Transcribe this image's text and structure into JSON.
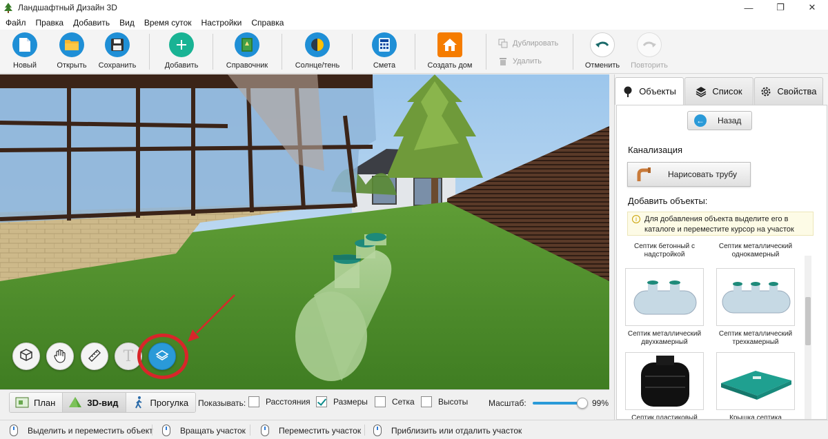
{
  "window": {
    "title": "Ландшафтный Дизайн 3D",
    "minimize": "—",
    "maximize": "❐",
    "close": "✕"
  },
  "menu": [
    "Файл",
    "Правка",
    "Добавить",
    "Вид",
    "Время суток",
    "Настройки",
    "Справка"
  ],
  "toolbar": {
    "new": "Новый",
    "open": "Открыть",
    "save": "Сохранить",
    "add": "Добавить",
    "reference": "Справочник",
    "sun_shadow": "Солнце/тень",
    "estimate": "Смета",
    "create_house": "Создать дом",
    "duplicate": "Дублировать",
    "delete": "Удалить",
    "undo": "Отменить",
    "redo": "Повторить"
  },
  "viewport_tools": {
    "text_tool": "T"
  },
  "modebar": {
    "plan": "План",
    "view3d": "3D-вид",
    "walk": "Прогулка",
    "show_label": "Показывать:",
    "distances": {
      "label": "Расстояния",
      "checked": false
    },
    "dimensions": {
      "label": "Размеры",
      "checked": true
    },
    "grid": {
      "label": "Сетка",
      "checked": false
    },
    "heights": {
      "label": "Высоты",
      "checked": false
    },
    "scale_label": "Масштаб:",
    "scale_value": "99%",
    "scale_fraction": 0.99
  },
  "status": {
    "select_move": "Выделить и переместить объект",
    "rotate": "Вращать участок",
    "move": "Переместить участок",
    "zoom": "Приблизить или отдалить участок"
  },
  "panel": {
    "tabs": [
      "Объекты",
      "Список",
      "Свойства"
    ],
    "back": "Назад",
    "category": "Канализация",
    "draw_pipe": "Нарисовать трубу",
    "add_objects": "Добавить объекты:",
    "hint": "Для добавления объекта выделите его в каталоге и переместите курсор на участок",
    "top_labels": [
      "Септик бетонный с надстройкой",
      "Септик металлический однокамерный"
    ],
    "objects": [
      {
        "name": "Септик металлический двухкамерный"
      },
      {
        "name": "Септик металлический трехкамерный"
      },
      {
        "name": "Септик пластиковый накопительный"
      },
      {
        "name": "Крышка септика"
      }
    ]
  },
  "colors": {
    "accent": "#2a9ad8",
    "lawn": "#4f8e2a",
    "fence": "#4a2f22",
    "septic_cap": "#1e8a7a",
    "highlight": "#d8262a"
  }
}
